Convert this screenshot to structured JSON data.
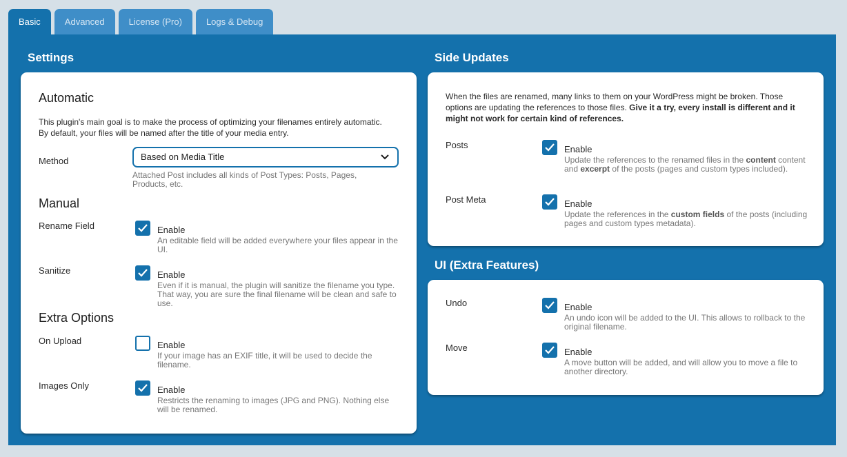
{
  "tabs": [
    {
      "label": "Basic",
      "active": true
    },
    {
      "label": "Advanced",
      "active": false
    },
    {
      "label": "License (Pro)",
      "active": false
    },
    {
      "label": "Logs & Debug",
      "active": false
    }
  ],
  "settings": {
    "title": "Settings",
    "automatic": {
      "heading": "Automatic",
      "intro": "This plugin's main goal is to make the process of optimizing your filenames entirely automatic. By default, your files will be named after the title of your media entry.",
      "method_label": "Method",
      "method_value": "Based on Media Title",
      "method_help": "Attached Post includes all kinds of Post Types: Posts, Pages, Products, etc."
    },
    "manual": {
      "heading": "Manual",
      "rows": [
        {
          "label": "Rename Field",
          "checked": true,
          "enable": "Enable",
          "help": "An editable field will be added everywhere your files appear in the UI."
        },
        {
          "label": "Sanitize",
          "checked": true,
          "enable": "Enable",
          "help": "Even if it is manual, the plugin will sanitize the filename you type. That way, you are sure the final filename will be clean and safe to use."
        }
      ]
    },
    "extra": {
      "heading": "Extra Options",
      "rows": [
        {
          "label": "On Upload",
          "checked": false,
          "enable": "Enable",
          "help": "If your image has an EXIF title, it will be used to decide the filename."
        },
        {
          "label": "Images Only",
          "checked": true,
          "enable": "Enable",
          "help": "Restricts the renaming to images (JPG and PNG). Nothing else will be renamed."
        }
      ]
    }
  },
  "side_updates": {
    "title": "Side Updates",
    "intro_plain": "When the files are renamed, many links to them on your WordPress might be broken. Those options are updating the references to those files. ",
    "intro_bold": "Give it a try, every install is different and it might not work for certain kind of references.",
    "rows": [
      {
        "label": "Posts",
        "checked": true,
        "enable": "Enable",
        "help_parts": [
          "Update the references to the renamed files in the ",
          "content",
          " content and ",
          "excerpt",
          " of the posts (pages and custom types included)."
        ]
      },
      {
        "label": "Post Meta",
        "checked": true,
        "enable": "Enable",
        "help_parts": [
          "Update the references in the ",
          "custom fields",
          " of the posts (including pages and custom types metadata)."
        ]
      }
    ]
  },
  "ui_extra": {
    "title": "UI (Extra Features)",
    "rows": [
      {
        "label": "Undo",
        "checked": true,
        "enable": "Enable",
        "help": "An undo icon will be added to the UI. This allows to rollback to the original filename."
      },
      {
        "label": "Move",
        "checked": true,
        "enable": "Enable",
        "help": "A move button will be added, and will allow you to move a file to another directory."
      }
    ]
  },
  "colors": {
    "accent": "#1471ac",
    "tab_inactive": "#3f8ec8",
    "page_bg": "#d6e0e7"
  }
}
